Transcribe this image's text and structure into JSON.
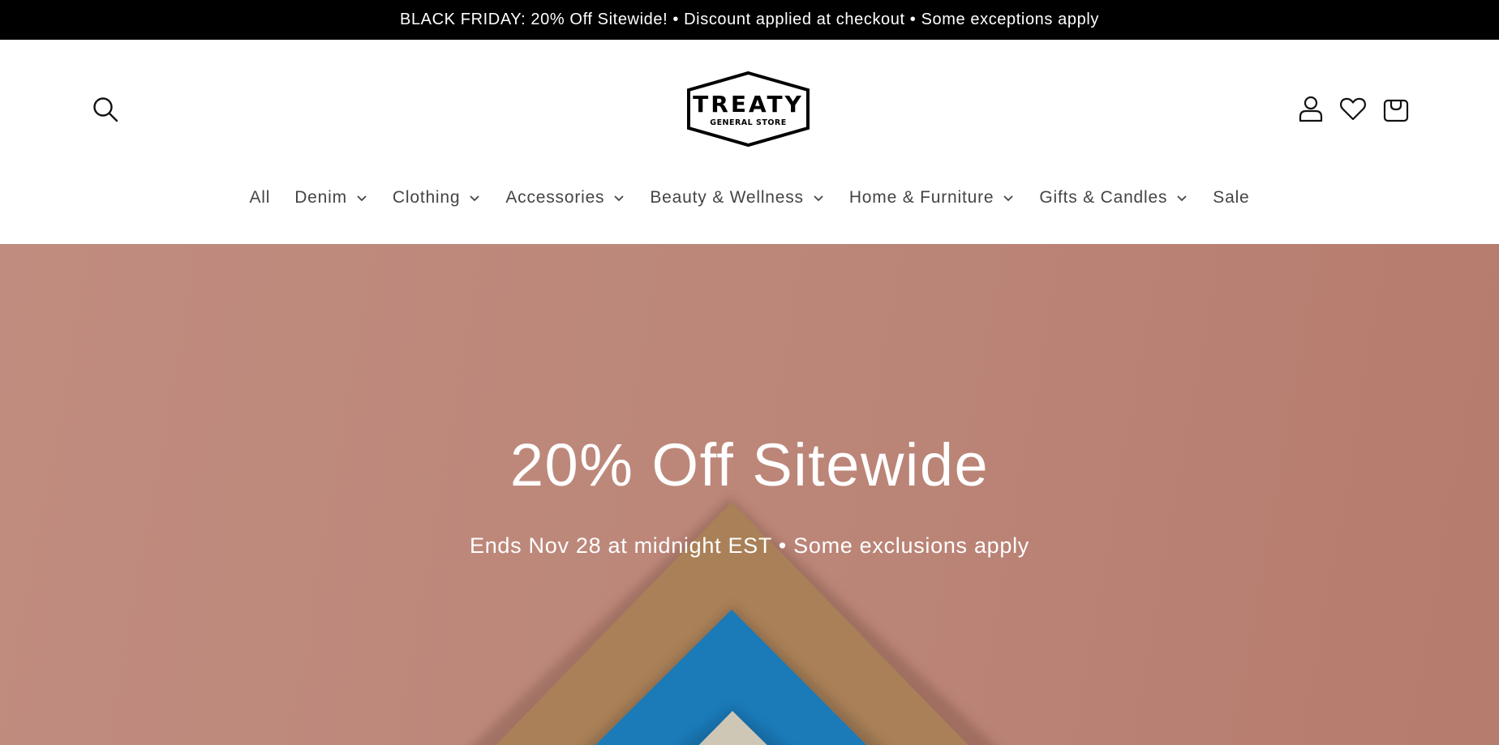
{
  "announcement": "BLACK FRIDAY: 20% Off Sitewide! • Discount applied at checkout • Some exceptions apply",
  "logo": {
    "text": "TREATY",
    "subtext": "GENERAL STORE"
  },
  "icons": {
    "search": "search-icon",
    "account": "account-icon",
    "wishlist": "heart-icon",
    "cart": "cart-icon",
    "dropdown": "chevron-down-icon"
  },
  "nav": {
    "items": [
      {
        "label": "All",
        "dropdown": false
      },
      {
        "label": "Denim",
        "dropdown": true
      },
      {
        "label": "Clothing",
        "dropdown": true
      },
      {
        "label": "Accessories",
        "dropdown": true
      },
      {
        "label": "Beauty & Wellness",
        "dropdown": true
      },
      {
        "label": "Home & Furniture",
        "dropdown": true
      },
      {
        "label": "Gifts & Candles",
        "dropdown": true
      },
      {
        "label": "Sale",
        "dropdown": false
      }
    ]
  },
  "hero": {
    "title": "20% Off Sitewide",
    "subtitle": "Ends Nov 28 at midnight EST • Some exclusions apply"
  },
  "colors": {
    "announcement_bg": "#000000",
    "hero_bg": "#bc8779",
    "paper_tan": "#a98057",
    "paper_blue": "#1b7ab8",
    "paper_beige": "#cfc7b6"
  }
}
